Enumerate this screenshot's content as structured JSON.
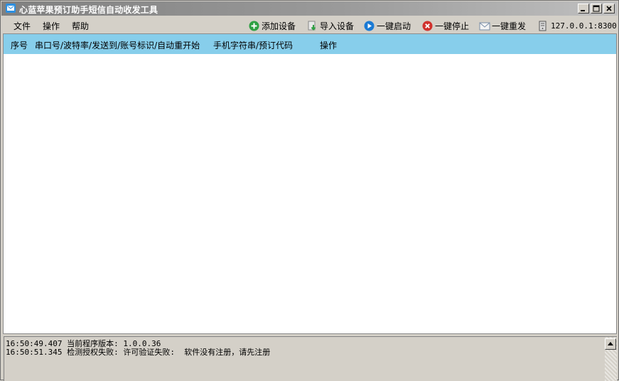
{
  "window": {
    "title": "心蓝苹果预订助手短信自动收发工具"
  },
  "menu": {
    "items": [
      "文件",
      "操作",
      "帮助"
    ]
  },
  "toolbar": {
    "add_device": "添加设备",
    "import_device": "导入设备",
    "start_all": "一键启动",
    "stop_all": "一键停止",
    "resend_all": "一键重发",
    "server": "127.0.0.1:8300"
  },
  "table": {
    "columns": [
      "序号",
      "串口号/波特率/发送到/账号标识/自动重开始",
      "手机字符串/预订代码",
      "操作"
    ],
    "rows": []
  },
  "log": {
    "lines": [
      "16:50:49.407 当前程序版本: 1.0.0.36",
      "16:50:51.345 检测授权失败: 许可验证失败:  软件没有注册，请先注册"
    ]
  },
  "colors": {
    "header_bg": "#87ceeb",
    "add_icon": "#2ea043",
    "start_icon": "#1a7ad4",
    "stop_icon": "#d0312d"
  }
}
